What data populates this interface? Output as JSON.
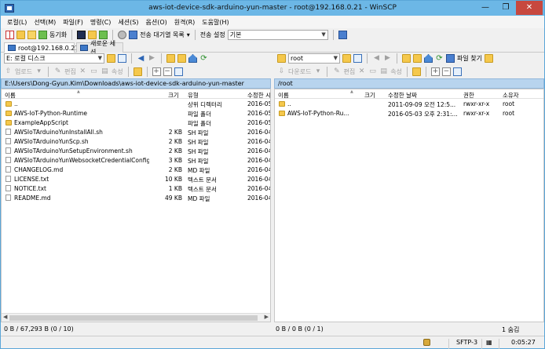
{
  "window": {
    "title": "aws-iot-device-sdk-arduino-yun-master - root@192.168.0.21 - WinSCP"
  },
  "menu": [
    "로컬(L)",
    "선택(M)",
    "파일(F)",
    "명령(C)",
    "세션(S)",
    "옵션(O)",
    "원격(R)",
    "도움말(H)"
  ],
  "toolbar": {
    "sync_label": "동기화",
    "queue_label": "전송 대기열 목록",
    "transfer_settings_label": "전송 설정",
    "transfer_settings_value": "기본"
  },
  "tabs": {
    "session": "root@192.168.0.21",
    "new_session": "새로운 세션"
  },
  "left": {
    "drive": "E: 로컬 디스크",
    "actions": {
      "upload": "업로드",
      "edit": "편집",
      "properties": "속성"
    },
    "path": "E:\\Users\\Dong-Gyun.Kim\\Downloads\\aws-iot-device-sdk-arduino-yun-master",
    "columns": {
      "name": "이름",
      "size": "크기",
      "type": "유형",
      "modified": "수정한 시"
    },
    "rows": [
      {
        "name": "..",
        "size": "",
        "type": "상위 디렉터리",
        "modified": "2016-05",
        "icon": "up"
      },
      {
        "name": "AWS-IoT-Python-Runtime",
        "size": "",
        "type": "파일 폴더",
        "modified": "2016-05",
        "icon": "folder"
      },
      {
        "name": "ExampleAppScript",
        "size": "",
        "type": "파일 폴더",
        "modified": "2016-05",
        "icon": "folder"
      },
      {
        "name": "AWSIoTArduinoYunInstallAll.sh",
        "size": "2 KB",
        "type": "SH 파일",
        "modified": "2016-04",
        "icon": "file"
      },
      {
        "name": "AWSIoTArduinoYunScp.sh",
        "size": "2 KB",
        "type": "SH 파일",
        "modified": "2016-04",
        "icon": "file"
      },
      {
        "name": "AWSIoTArduinoYunSetupEnvironment.sh",
        "size": "2 KB",
        "type": "SH 파일",
        "modified": "2016-04",
        "icon": "file"
      },
      {
        "name": "AWSIoTArduinoYunWebsocketCredentialConfig...",
        "size": "3 KB",
        "type": "SH 파일",
        "modified": "2016-04",
        "icon": "file"
      },
      {
        "name": "CHANGELOG.md",
        "size": "2 KB",
        "type": "MD 파일",
        "modified": "2016-04",
        "icon": "file"
      },
      {
        "name": "LICENSE.txt",
        "size": "10 KB",
        "type": "텍스트 문서",
        "modified": "2016-04",
        "icon": "file"
      },
      {
        "name": "NOTICE.txt",
        "size": "1 KB",
        "type": "텍스트 문서",
        "modified": "2016-04",
        "icon": "file"
      },
      {
        "name": "README.md",
        "size": "49 KB",
        "type": "MD 파일",
        "modified": "2016-04",
        "icon": "file"
      }
    ],
    "status": "0 B / 67,293 B (0 / 10)"
  },
  "right": {
    "folder": "root",
    "find_files": "파일 찾기",
    "actions": {
      "download": "다운로드",
      "edit": "편집",
      "properties": "속성"
    },
    "path": "/root",
    "columns": {
      "name": "이름",
      "size": "크기",
      "modified": "수정한 날짜",
      "rights": "권한",
      "owner": "소유자"
    },
    "rows": [
      {
        "name": "..",
        "size": "",
        "modified": "2011-09-09 오전 12:5...",
        "rights": "rwxr-xr-x",
        "owner": "root",
        "icon": "up"
      },
      {
        "name": "AWS-IoT-Python-Ru...",
        "size": "",
        "modified": "2016-05-03 오후 2:31:...",
        "rights": "rwxr-xr-x",
        "owner": "root",
        "icon": "folder"
      }
    ],
    "status": "0 B / 0 B (0 / 1)",
    "hidden": "1 숨김"
  },
  "statusbar": {
    "protocol": "SFTP-3",
    "time": "0:05:27"
  }
}
